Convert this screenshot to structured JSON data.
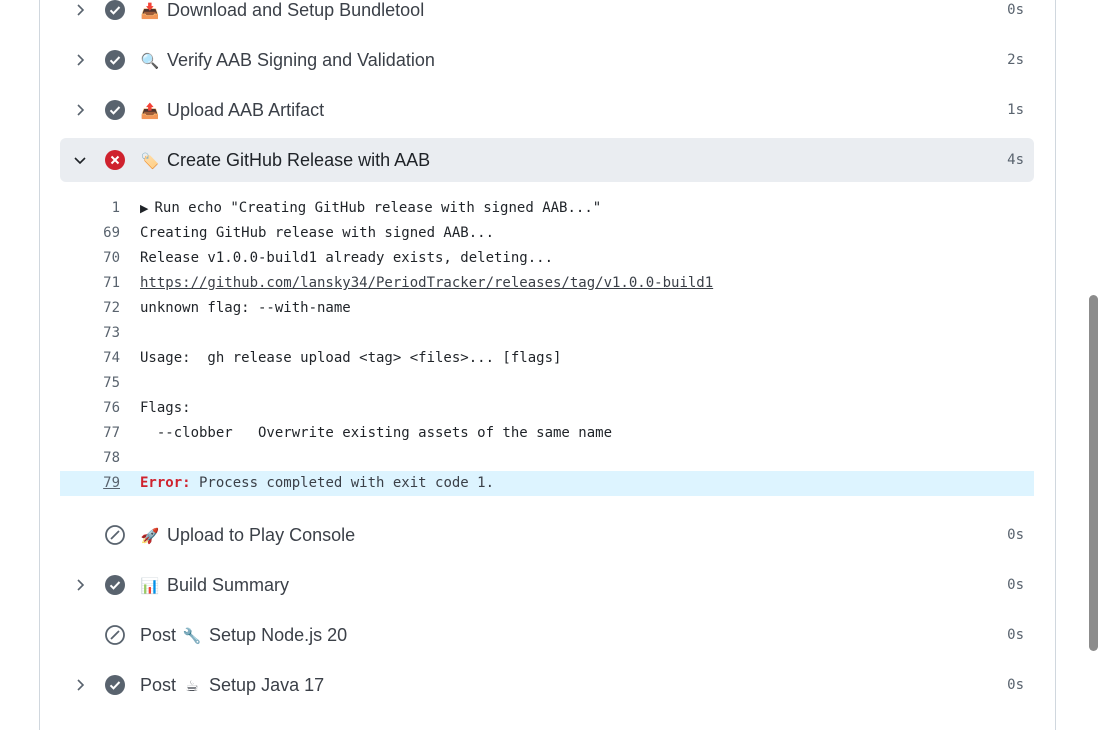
{
  "steps": [
    {
      "title": "Download and Setup Bundletool",
      "emoji": "📥",
      "duration": "0s",
      "status": "success"
    },
    {
      "title": "Verify AAB Signing and Validation",
      "emoji": "🔍",
      "duration": "2s",
      "status": "success"
    },
    {
      "title": "Upload AAB Artifact",
      "emoji": "📤",
      "duration": "1s",
      "status": "success"
    },
    {
      "title": "Create GitHub Release with AAB",
      "emoji": "🏷️",
      "duration": "4s",
      "status": "failure"
    },
    {
      "title": "Upload to Play Console",
      "emoji": "🚀",
      "duration": "0s",
      "status": "skipped"
    },
    {
      "title": "Build Summary",
      "emoji": "📊",
      "duration": "0s",
      "status": "success"
    },
    {
      "prefix": "Post",
      "title": "Setup Node.js 20",
      "emoji": "🔧",
      "duration": "0s",
      "status": "skipped"
    },
    {
      "prefix": "Post",
      "title": "Setup Java 17",
      "emoji": "☕",
      "duration": "0s",
      "status": "success"
    }
  ],
  "log": {
    "lines": [
      {
        "num": "1",
        "text": "Run echo \"Creating GitHub release with signed AAB...\""
      },
      {
        "num": "69",
        "text": "Creating GitHub release with signed AAB..."
      },
      {
        "num": "70",
        "text": "Release v1.0.0-build1 already exists, deleting..."
      },
      {
        "num": "71",
        "link": "https://github.com/lansky34/PeriodTracker/releases/tag/v1.0.0-build1"
      },
      {
        "num": "72",
        "text": "unknown flag: --with-name"
      },
      {
        "num": "73",
        "text": ""
      },
      {
        "num": "74",
        "text": "Usage:  gh release upload <tag> <files>... [flags]"
      },
      {
        "num": "75",
        "text": ""
      },
      {
        "num": "76",
        "text": "Flags:"
      },
      {
        "num": "77",
        "text": "  --clobber   Overwrite existing assets of the same name"
      },
      {
        "num": "78",
        "text": ""
      }
    ],
    "error": {
      "num": "79",
      "label": "Error:",
      "message": " Process completed with exit code 1."
    }
  },
  "colors": {
    "success": "#59636e",
    "failure": "#cf222e",
    "skipped": "#59636e",
    "error_bg": "#ddf4ff"
  }
}
